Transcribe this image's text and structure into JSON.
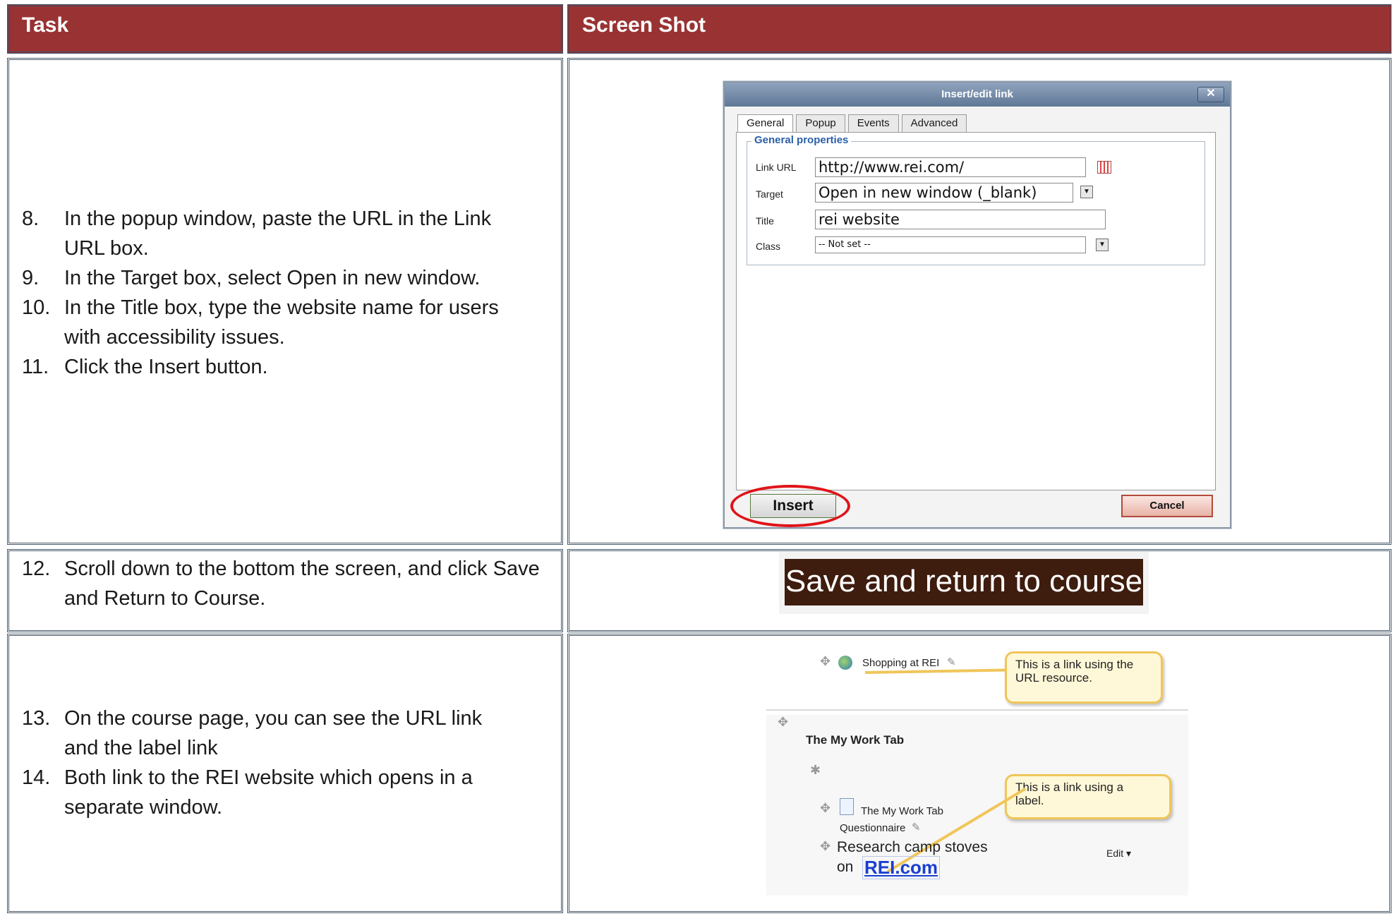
{
  "header": {
    "task": "Task",
    "screenshot": "Screen Shot"
  },
  "rows": [
    {
      "steps": [
        {
          "num": "8.",
          "lines": [
            "In the popup window, paste the URL in the Link",
            "URL box."
          ]
        },
        {
          "num": "9.",
          "lines": [
            "In the Target box, select Open in new window."
          ]
        },
        {
          "num": "10.",
          "lines": [
            "In the Title box, type the website name for users",
            "with accessibility issues."
          ]
        },
        {
          "num": "11.",
          "lines": [
            "Click the Insert button."
          ]
        }
      ]
    },
    {
      "steps": [
        {
          "num": "12.",
          "lines": [
            "Scroll down to the bottom the screen, and click Save",
            "and Return to Course."
          ]
        }
      ]
    },
    {
      "steps": [
        {
          "num": "13.",
          "lines": [
            "On the course page, you can see the URL link",
            "and the label link"
          ]
        },
        {
          "num": "14.",
          "lines": [
            "Both link to the REI website which opens in a",
            "separate window."
          ]
        }
      ]
    }
  ],
  "dialog": {
    "title": "Insert/edit link",
    "close": "✕",
    "tabs": [
      "General",
      "Popup",
      "Events",
      "Advanced"
    ],
    "legend": "General properties",
    "fields": {
      "link_url_label": "Link URL",
      "link_url_value": "http://www.rei.com/",
      "target_label": "Target",
      "target_value": "Open in new window (_blank)",
      "title_label": "Title",
      "title_value": "rei website",
      "class_label": "Class",
      "class_value": "-- Not set --"
    },
    "insert": "Insert",
    "cancel": "Cancel"
  },
  "save_button": "Save and return to course",
  "course": {
    "shopping_link": "Shopping at REI",
    "callout1": [
      "This is a link using the",
      "URL resource."
    ],
    "section_title": "The My Work Tab",
    "questionnaire": [
      "The My Work Tab",
      "Questionnaire"
    ],
    "callout2": [
      "This is a link using a",
      "label."
    ],
    "label_text": [
      "Research camp stoves",
      "on "
    ],
    "label_link": "REI.com",
    "edit": "Edit ▾"
  },
  "colors": {
    "header": "#993333",
    "save_bg": "#3e1c0e",
    "callout_border": "#f0c65a",
    "highlight": "#e0141a"
  }
}
